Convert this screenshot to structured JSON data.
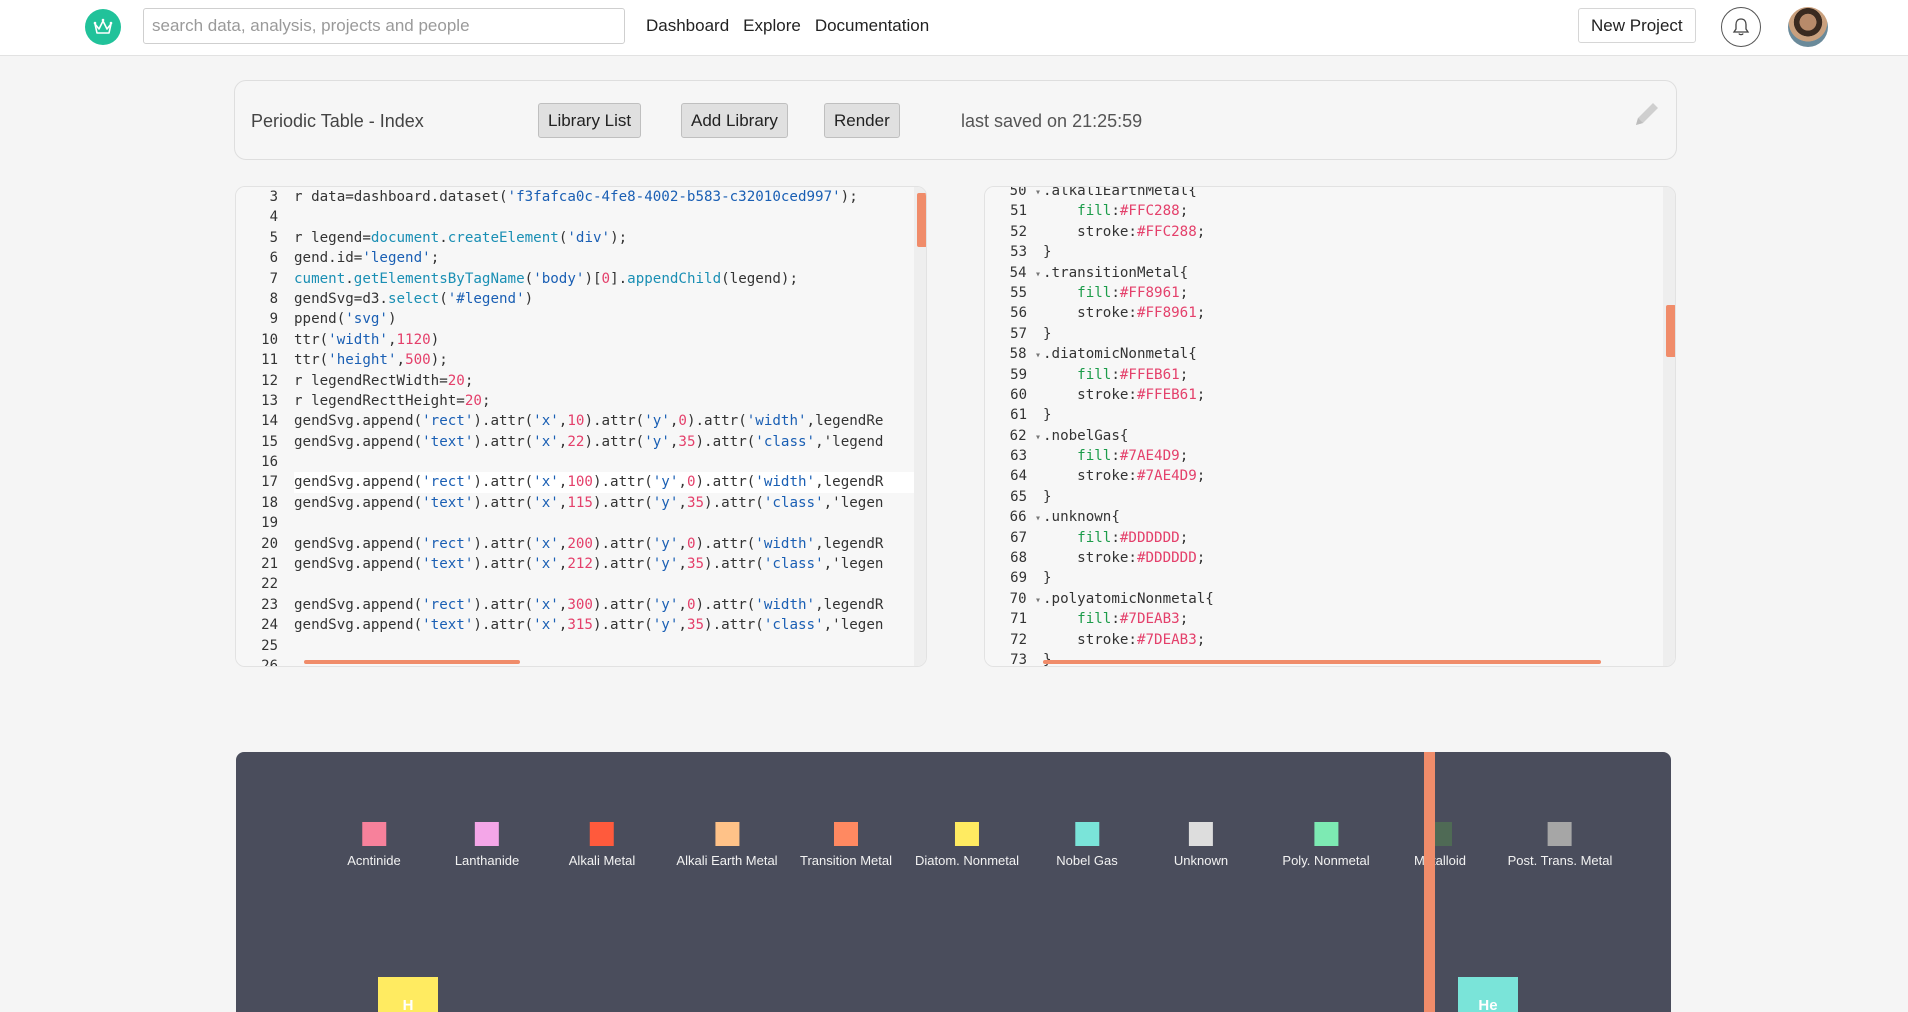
{
  "nav": {
    "search_placeholder": "search data, analysis, projects and people",
    "links": [
      "Dashboard",
      "Explore",
      "Documentation"
    ],
    "new_project_label": "New Project"
  },
  "toolbar": {
    "project_title": "Periodic Table - Index",
    "library_list_label": "Library List",
    "add_library_label": "Add Library",
    "render_label": "Render",
    "saved_text": "last saved on 21:25:59"
  },
  "js_editor": {
    "line_numbers": [
      "3",
      "4",
      "5",
      "6",
      "7",
      "8",
      "9",
      "10",
      "11",
      "12",
      "13",
      "14",
      "15",
      "16",
      "17",
      "18",
      "19",
      "20",
      "21",
      "22",
      "23",
      "24",
      "25",
      "26"
    ],
    "lines": [
      "r data=dashboard.dataset('f3fafca0c-4fe8-4002-b583-c32010ced997');",
      "",
      "r legend=document.createElement('div');",
      "gend.id='legend';",
      "cument.getElementsByTagName('body')[0].appendChild(legend);",
      "gendSvg=d3.select('#legend')",
      "ppend('svg')",
      "ttr('width',1120)",
      "ttr('height',500);",
      "r legendRectWidth=20;",
      "r legendRecttHeight=20;",
      "gendSvg.append('rect').attr('x',10).attr('y',0).attr('width',legendRe",
      "gendSvg.append('text').attr('x',22).attr('y',35).attr('class','legend",
      "",
      "gendSvg.append('rect').attr('x',100).attr('y',0).attr('width',legendR",
      "gendSvg.append('text').attr('x',115).attr('y',35).attr('class','legen",
      "",
      "gendSvg.append('rect').attr('x',200).attr('y',0).attr('width',legendR",
      "gendSvg.append('text').attr('x',212).attr('y',35).attr('class','legen",
      "",
      "gendSvg.append('rect').attr('x',300).attr('y',0).attr('width',legendR",
      "gendSvg.append('text').attr('x',315).attr('y',35).attr('class','legen",
      "",
      ""
    ]
  },
  "css_editor": {
    "line_numbers": [
      "50",
      "51",
      "52",
      "53",
      "54",
      "55",
      "56",
      "57",
      "58",
      "59",
      "60",
      "61",
      "62",
      "63",
      "64",
      "65",
      "66",
      "67",
      "68",
      "69",
      "70",
      "71",
      "72",
      "73"
    ],
    "lines": [
      ".alkaliEarthMetal{",
      "    fill:#FFC288;",
      "    stroke:#FFC288;",
      "}",
      ".transitionMetal{",
      "    fill:#FF8961;",
      "    stroke:#FF8961;",
      "}",
      ".diatomicNonmetal{",
      "    fill:#FFEB61;",
      "    stroke:#FFEB61;",
      "}",
      ".nobelGas{",
      "    fill:#7AE4D9;",
      "    stroke:#7AE4D9;",
      "}",
      ".unknown{",
      "    fill:#DDDDDD;",
      "    stroke:#DDDDDD;",
      "}",
      ".polyatomicNonmetal{",
      "    fill:#7DEAB3;",
      "    stroke:#7DEAB3;",
      "}"
    ]
  },
  "legend": [
    {
      "label": "Acntinide",
      "color": "#F7819B"
    },
    {
      "label": "Lanthanide",
      "color": "#F4A6E8"
    },
    {
      "label": "Alkali Metal",
      "color": "#FF5A3C"
    },
    {
      "label": "Alkali Earth Metal",
      "color": "#FFC288"
    },
    {
      "label": "Transition Metal",
      "color": "#FF8961"
    },
    {
      "label": "Diatom. Nonmetal",
      "color": "#FFEB61"
    },
    {
      "label": "Nobel Gas",
      "color": "#7AE4D9"
    },
    {
      "label": "Unknown",
      "color": "#DDDDDD"
    },
    {
      "label": "Poly. Nonmetal",
      "color": "#7DEAB3"
    },
    {
      "label": "Metalloid",
      "color": "#4F6A55"
    },
    {
      "label": "Post. Trans. Metal",
      "color": "#A6A6A6"
    }
  ],
  "elements": [
    {
      "symbol": "H",
      "color": "#FFEB61"
    },
    {
      "symbol": "He",
      "color": "#7AE4D9"
    }
  ],
  "colors": {
    "brand": "#21C29A",
    "accent": "#F08C6A",
    "render_bg": "#4A4D5C"
  }
}
